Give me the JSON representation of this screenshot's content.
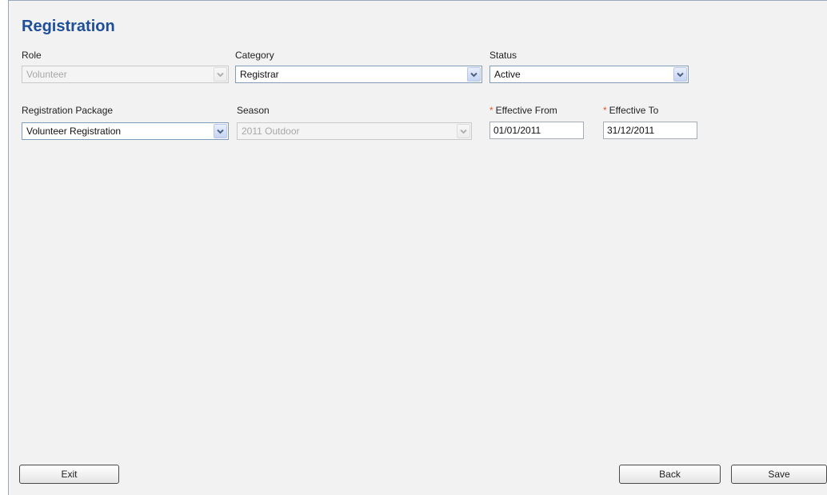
{
  "page": {
    "title": "Registration"
  },
  "form": {
    "role": {
      "label": "Role",
      "value": "Volunteer",
      "disabled": true
    },
    "category": {
      "label": "Category",
      "value": "Registrar",
      "disabled": false
    },
    "status": {
      "label": "Status",
      "value": "Active",
      "disabled": false
    },
    "registration_package": {
      "label": "Registration Package",
      "value": "Volunteer Registration",
      "disabled": false
    },
    "season": {
      "label": "Season",
      "value": "2011 Outdoor",
      "disabled": true
    },
    "effective_from": {
      "required_marker": "*",
      "label": "Effective From",
      "value": "01/01/2011"
    },
    "effective_to": {
      "required_marker": "*",
      "label": "Effective To",
      "value": "31/12/2011"
    }
  },
  "buttons": {
    "exit": "Exit",
    "back": "Back",
    "save": "Save"
  },
  "colors": {
    "title": "#1f4e9a",
    "required": "#e05a2a",
    "background": "#f2f2f2"
  }
}
